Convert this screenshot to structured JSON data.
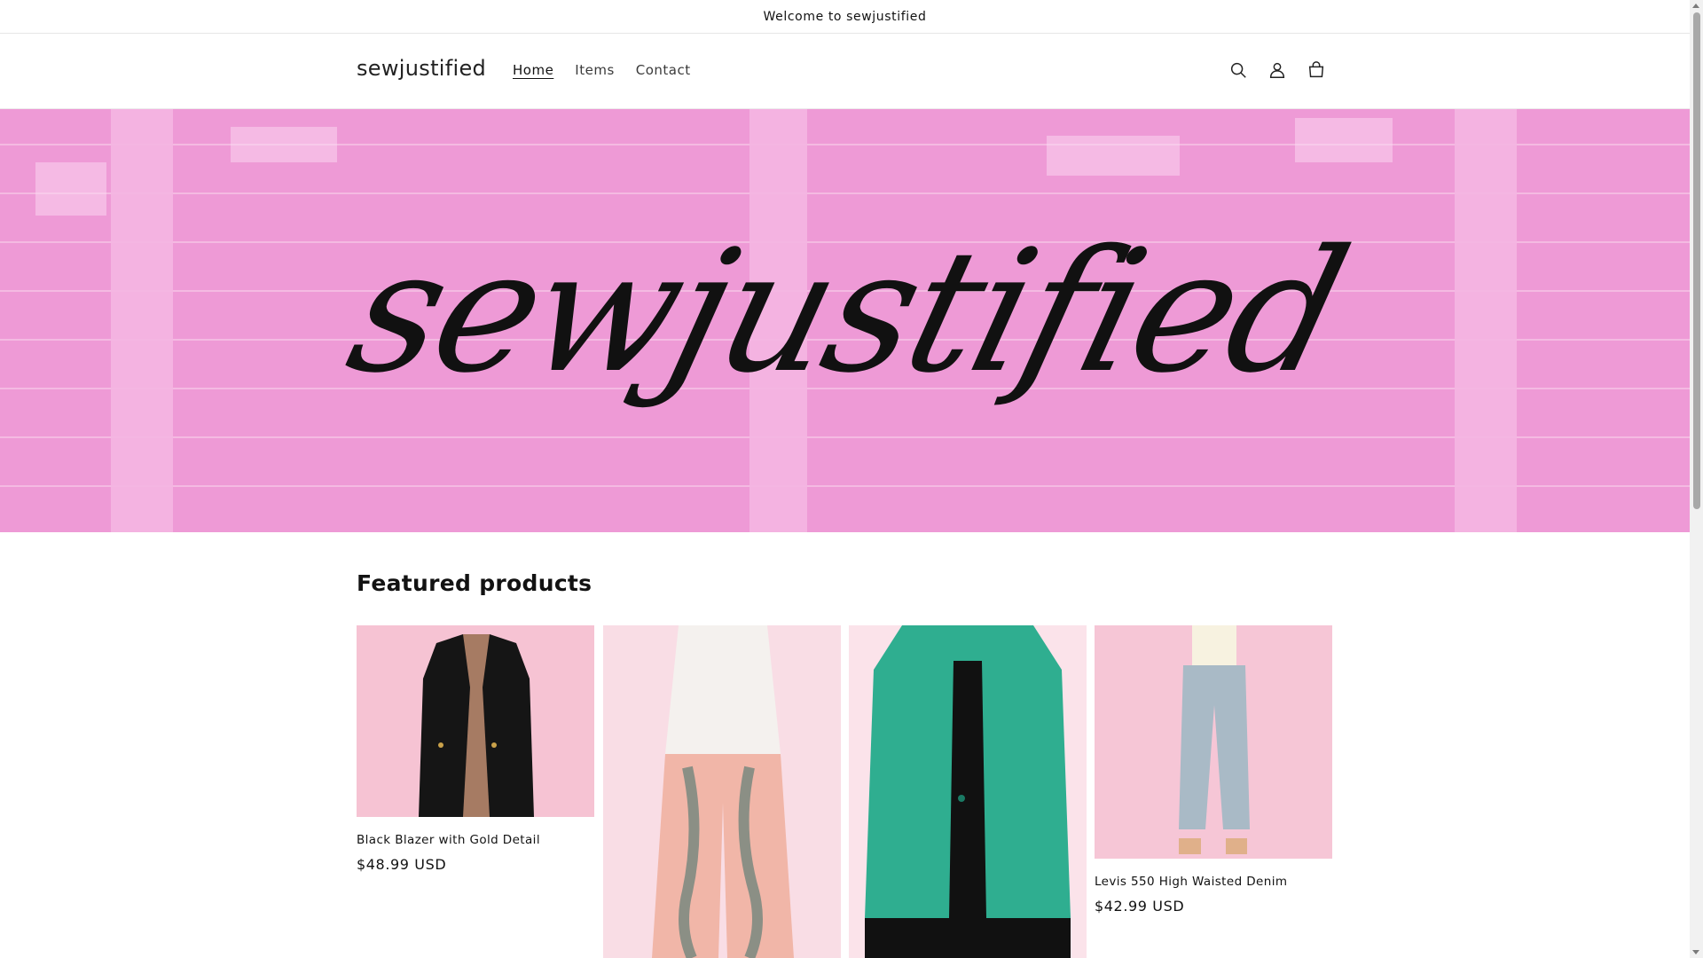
{
  "announcement": {
    "text": "Welcome to sewjustified"
  },
  "header": {
    "logo": "sewjustified",
    "nav": [
      {
        "label": "Home",
        "active": true
      },
      {
        "label": "Items",
        "active": false
      },
      {
        "label": "Contact",
        "active": false
      }
    ],
    "icons": [
      "search-icon",
      "account-icon",
      "cart-icon"
    ]
  },
  "hero": {
    "title": "sewjustified",
    "background_color": "#ee9ad6"
  },
  "featured": {
    "heading": "Featured products",
    "products": [
      {
        "name": "Black Blazer with Gold Detail",
        "price": "$48.99 USD"
      },
      {
        "name": "",
        "price": ""
      },
      {
        "name": "",
        "price": ""
      },
      {
        "name": "Levis 550 High Waisted Denim",
        "price": "$42.99 USD"
      }
    ]
  },
  "colors": {
    "text": "#121212",
    "hero_pink": "#ee9ad6",
    "product_bg_pink": "#f8c6d6"
  }
}
